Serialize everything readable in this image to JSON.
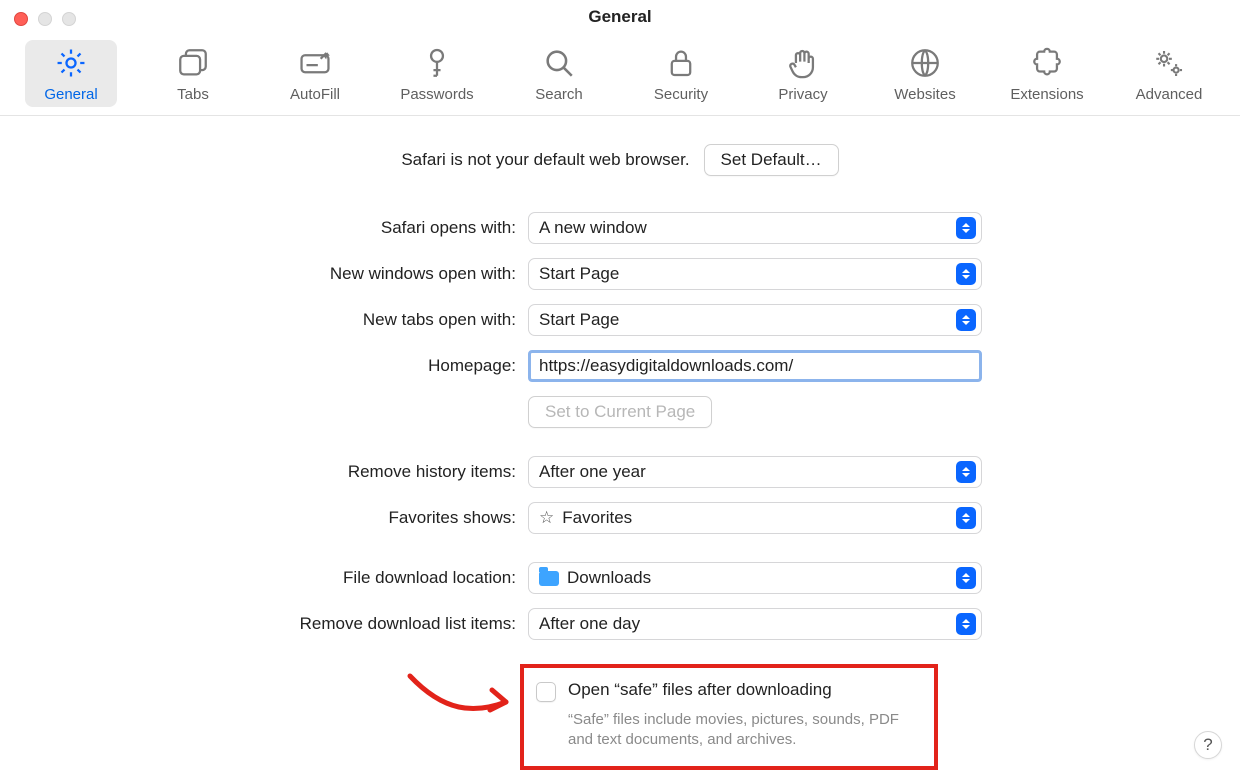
{
  "window": {
    "title": "General"
  },
  "toolbar": {
    "items": [
      {
        "label": "General",
        "icon": "gear-icon",
        "active": true
      },
      {
        "label": "Tabs",
        "icon": "tabs-icon",
        "active": false
      },
      {
        "label": "AutoFill",
        "icon": "autofill-icon",
        "active": false
      },
      {
        "label": "Passwords",
        "icon": "key-icon",
        "active": false
      },
      {
        "label": "Search",
        "icon": "search-icon",
        "active": false
      },
      {
        "label": "Security",
        "icon": "lock-icon",
        "active": false
      },
      {
        "label": "Privacy",
        "icon": "hand-icon",
        "active": false
      },
      {
        "label": "Websites",
        "icon": "globe-icon",
        "active": false
      },
      {
        "label": "Extensions",
        "icon": "puzzle-icon",
        "active": false
      },
      {
        "label": "Advanced",
        "icon": "gears-icon",
        "active": false
      }
    ]
  },
  "default_browser": {
    "message": "Safari is not your default web browser.",
    "button": "Set Default…"
  },
  "rows": {
    "safari_opens_with": {
      "label": "Safari opens with:",
      "value": "A new window"
    },
    "new_windows_open": {
      "label": "New windows open with:",
      "value": "Start Page"
    },
    "new_tabs_open": {
      "label": "New tabs open with:",
      "value": "Start Page"
    },
    "homepage": {
      "label": "Homepage:",
      "value": "https://easydigitaldownloads.com/"
    },
    "set_current_page": {
      "button": "Set to Current Page"
    },
    "remove_history": {
      "label": "Remove history items:",
      "value": "After one year"
    },
    "favorites_shows": {
      "label": "Favorites shows:",
      "value": "Favorites"
    },
    "download_location": {
      "label": "File download location:",
      "value": "Downloads"
    },
    "remove_download_list": {
      "label": "Remove download list items:",
      "value": "After one day"
    }
  },
  "safe_files": {
    "checked": false,
    "title": "Open “safe” files after downloading",
    "description": "“Safe” files include movies, pictures, sounds, PDF and text documents, and archives."
  },
  "help_button": "?"
}
